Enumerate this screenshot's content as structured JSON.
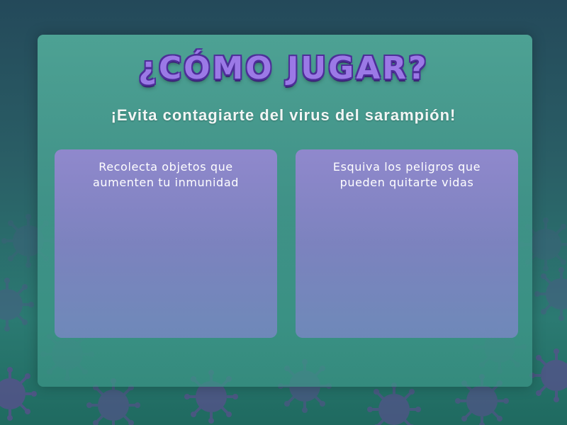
{
  "screen": {
    "title": "¿CÓMO JUGAR?",
    "subtitle": "¡Evita contagiarte del virus del sarampión!",
    "cards": [
      {
        "text": "Recolecta objetos que\naumenten tu inmunidad"
      },
      {
        "text": "Esquiva los peligros que\npueden quitarte vidas"
      }
    ]
  },
  "colors": {
    "background": "#2a5f66",
    "panel": "#56b4a0",
    "card": "#9687d2",
    "title": "#9b79e6",
    "title_outline": "#4e2f99",
    "virus": "#5b4f8f"
  },
  "decorations": {
    "background_icon": "virus-icon"
  }
}
